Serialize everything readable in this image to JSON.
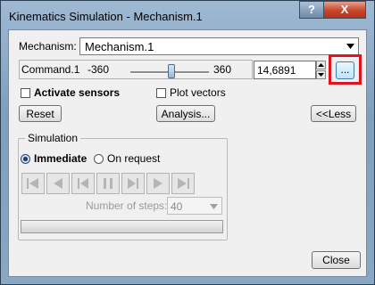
{
  "window": {
    "title": "Kinematics Simulation - Mechanism.1",
    "help_label": "?",
    "close_label": "X"
  },
  "mechanism": {
    "label": "Mechanism:",
    "value": "Mechanism.1"
  },
  "command": {
    "name": "Command.1",
    "min": "-360",
    "max": "360",
    "value": "14,6891",
    "slider_fraction": 0.52,
    "more_label": "..."
  },
  "options": {
    "activate_sensors": "Activate sensors",
    "plot_vectors": "Plot vectors"
  },
  "buttons": {
    "reset": "Reset",
    "analysis": "Analysis...",
    "less": "<<Less",
    "close": "Close"
  },
  "simulation": {
    "group_label": "Simulation",
    "immediate": "Immediate",
    "on_request": "On request",
    "steps_label": "Number of steps:",
    "steps_value": "40"
  },
  "colors": {
    "highlight": "#e0141e"
  }
}
